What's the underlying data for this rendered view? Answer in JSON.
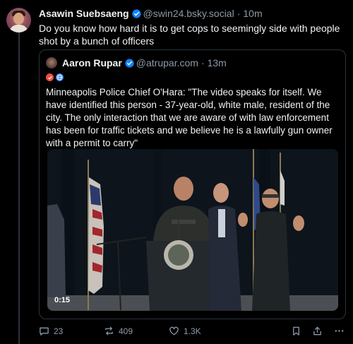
{
  "post": {
    "author": {
      "display_name": "Asawin Suebsaeng",
      "handle": "@swin24.bsky.social",
      "time": "10m"
    },
    "text": "Do you know how hard it is to get cops to seemingly side with people shot by a bunch of officers",
    "quote": {
      "author": {
        "display_name": "Aaron Rupar",
        "handle": "@atrupar.com",
        "time": "13m"
      },
      "text": "Minneapolis Police Chief O'Hara: \"The video speaks for itself. We have identified this person - 37-year-old, white male, resident of the city. The only interaction that we are aware of with law enforcement has been for traffic tickets and we believe he is a lawfully gun owner with a permit to carry\"",
      "video": {
        "duration": "0:15",
        "icon": "video-thumbnail"
      }
    },
    "actions": {
      "replies": "23",
      "reposts": "409",
      "likes": "1.3K"
    }
  },
  "colors": {
    "background": "#000000",
    "text": "#f1f3f5",
    "muted": "#8d99a6",
    "verified": "#1083fe",
    "border": "#2b333b"
  }
}
